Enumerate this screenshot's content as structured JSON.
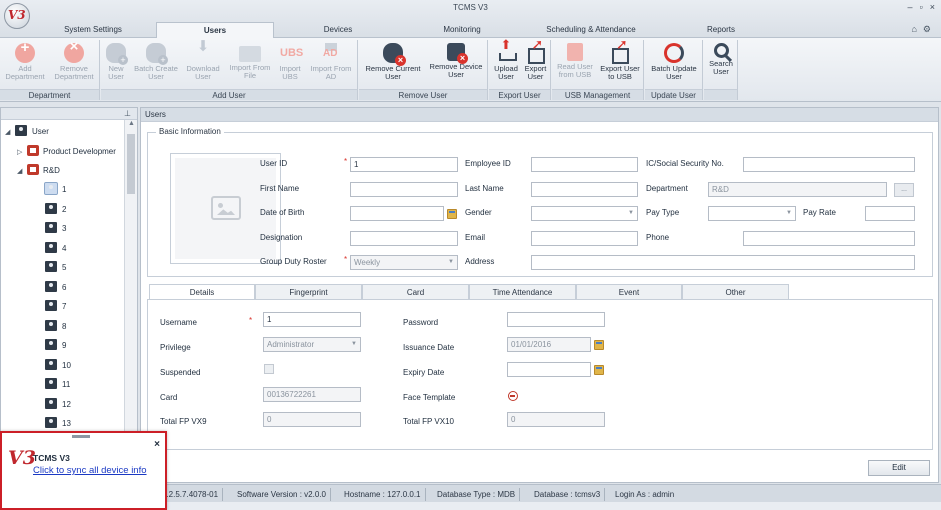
{
  "window": {
    "title": "TCMS V3",
    "controls": [
      "–",
      "▫",
      "×"
    ],
    "logo_text": "V3"
  },
  "tabs": [
    {
      "label": "System Settings"
    },
    {
      "label": "Users"
    },
    {
      "label": "Devices"
    },
    {
      "label": "Monitoring"
    },
    {
      "label": "Scheduling & Attendance"
    },
    {
      "label": "Reports"
    }
  ],
  "ribbon": {
    "groups": [
      {
        "label": "Department",
        "buttons": [
          {
            "label": "Add Department",
            "icon": "add-circle-icon",
            "enabled": false
          },
          {
            "label": "Remove Department",
            "icon": "remove-circle-icon",
            "enabled": false
          }
        ]
      },
      {
        "label": "Add User",
        "buttons": [
          {
            "label": "New User",
            "icon": "new-user-icon",
            "enabled": false
          },
          {
            "label": "Batch Create User",
            "icon": "batch-create-icon",
            "enabled": false
          },
          {
            "label": "Download User",
            "icon": "download-icon",
            "enabled": false
          },
          {
            "label": "Import From File",
            "icon": "folder-icon",
            "enabled": false
          },
          {
            "label": "Import UBS",
            "icon": "ubs-icon",
            "enabled": false
          },
          {
            "label": "Import From AD",
            "icon": "ad-icon",
            "enabled": false
          }
        ]
      },
      {
        "label": "Remove User",
        "buttons": [
          {
            "label": "Remove Current User",
            "icon": "remove-user-icon",
            "enabled": true
          },
          {
            "label": "Remove Device User",
            "icon": "remove-device-user-icon",
            "enabled": true
          }
        ]
      },
      {
        "label": "Export User",
        "buttons": [
          {
            "label": "Upload User",
            "icon": "upload-icon",
            "enabled": true
          },
          {
            "label": "Export User",
            "icon": "export-icon",
            "enabled": true
          }
        ]
      },
      {
        "label": "USB Management",
        "buttons": [
          {
            "label": "Read User from USB",
            "icon": "usb-read-icon",
            "enabled": false
          },
          {
            "label": "Export User to USB",
            "icon": "export-usb-icon",
            "enabled": true
          }
        ]
      },
      {
        "label": "Update User",
        "buttons": [
          {
            "label": "Batch Update User",
            "icon": "sync-icon",
            "enabled": true
          }
        ]
      },
      {
        "label": "",
        "buttons": [
          {
            "label": "Search User",
            "icon": "search-icon",
            "enabled": true
          }
        ]
      }
    ]
  },
  "tree": {
    "root": "User",
    "groups": [
      "Product Developmer",
      "R&D"
    ],
    "users": [
      "1",
      "2",
      "3",
      "4",
      "5",
      "6",
      "7",
      "8",
      "9",
      "10",
      "11",
      "12",
      "13"
    ],
    "selected_user": "1"
  },
  "main": {
    "title": "Users",
    "basic_info": {
      "legend": "Basic Information",
      "user_id_label": "User ID",
      "user_id": "1",
      "employee_id_label": "Employee ID",
      "employee_id": "",
      "ic_label": "IC/Social Security No.",
      "ic": "",
      "first_name_label": "First Name",
      "first_name": "",
      "last_name_label": "Last Name",
      "last_name": "",
      "department_label": "Department",
      "department": "R&D",
      "dob_label": "Date of Birth",
      "dob": "",
      "gender_label": "Gender",
      "gender": "",
      "pay_type_label": "Pay Type",
      "pay_type": "",
      "pay_rate_label": "Pay Rate",
      "pay_rate": "",
      "designation_label": "Designation",
      "designation": "",
      "email_label": "Email",
      "email": "",
      "phone_label": "Phone",
      "phone": "",
      "roster_label": "Group Duty Roster",
      "roster": "Weekly",
      "address_label": "Address",
      "address": "",
      "department_button": "..."
    },
    "detail_tabs": [
      "Details",
      "Fingerprint",
      "Card",
      "Time Attendance",
      "Event",
      "Other"
    ],
    "details": {
      "username_label": "Username",
      "username": "1",
      "password_label": "Password",
      "password": "",
      "privilege_label": "Privilege",
      "privilege": "Administrator",
      "issuance_label": "Issuance Date",
      "issuance": "01/01/2016",
      "suspended_label": "Suspended",
      "expiry_label": "Expiry Date",
      "expiry": "",
      "card_label": "Card",
      "card": "00136722261",
      "face_label": "Face Template",
      "fp9_label": "Total FP VX9",
      "fp9": "0",
      "fp10_label": "Total FP VX10",
      "fp10": "0"
    },
    "edit_button": "Edit"
  },
  "status": {
    "segments": [
      "3.2.5.7.4078-01",
      "Software Version : v2.0.0",
      "Hostname : 127.0.0.1",
      "Database Type : MDB",
      "Database : tcmsv3",
      "Login As : admin"
    ]
  },
  "popup": {
    "logo_text": "V3",
    "title": "TCMS V3",
    "link": "Click to sync all device info",
    "close": "×"
  },
  "colors": {
    "accent_red": "#d9332c",
    "link_blue": "#1a39c4",
    "popup_border": "#cc1f27"
  }
}
